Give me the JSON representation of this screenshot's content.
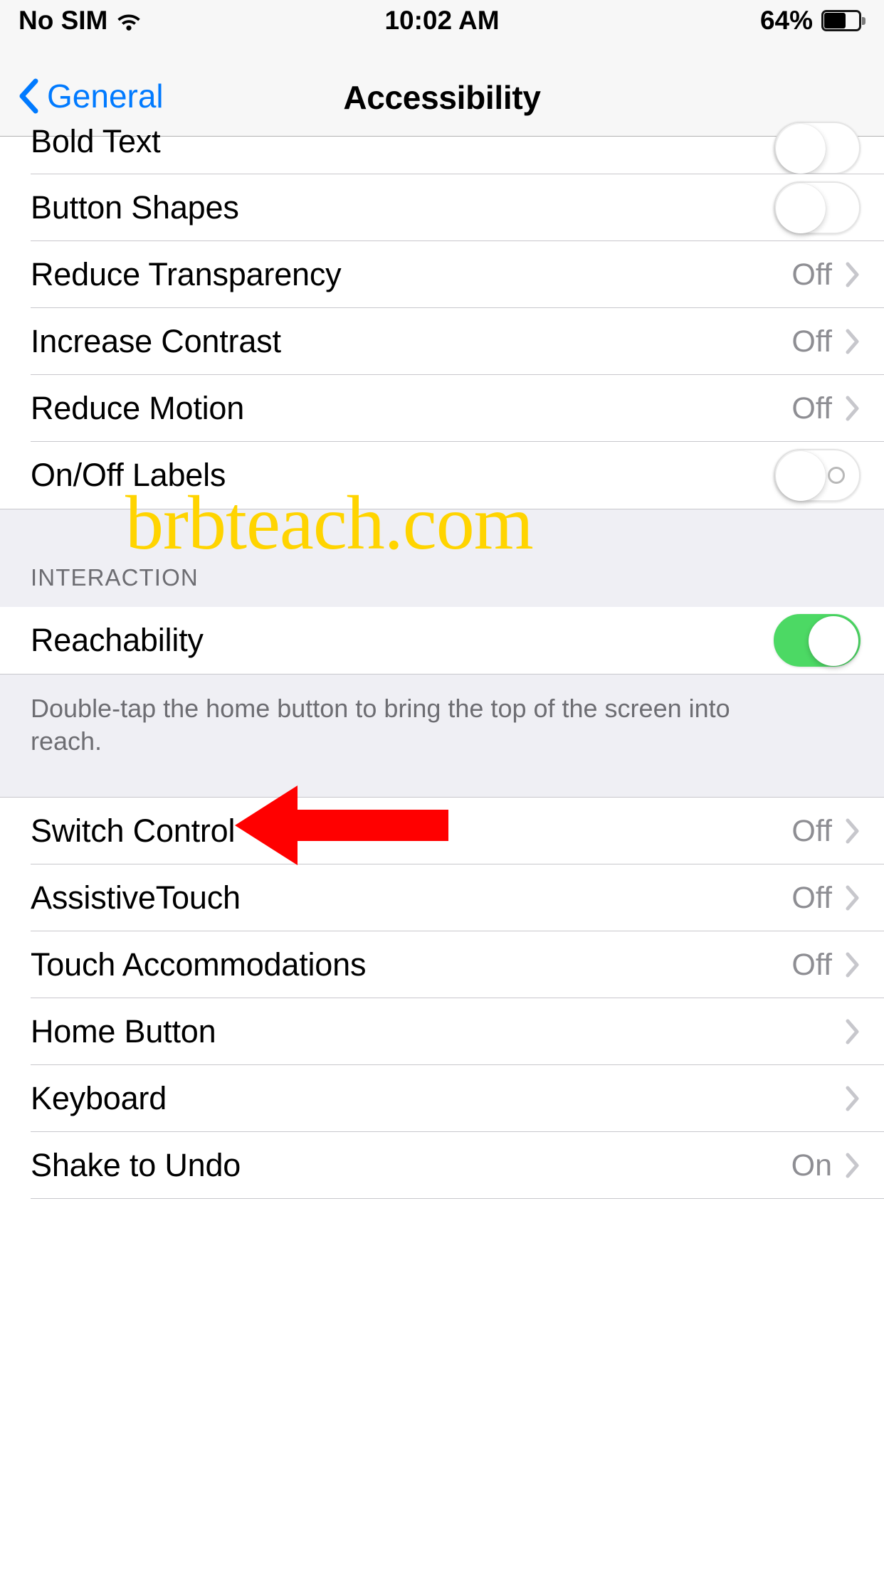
{
  "status_bar": {
    "carrier": "No SIM",
    "wifi_icon": "wifi-icon",
    "time": "10:02 AM",
    "battery_percent": "64%",
    "battery_icon": "battery-icon"
  },
  "nav_bar": {
    "back_label": "General",
    "back_icon": "chevron-left-icon",
    "title": "Accessibility"
  },
  "vision_section": {
    "rows": [
      {
        "label": "Bold Text",
        "control": "toggle",
        "toggle_on": false,
        "clipped": true
      },
      {
        "label": "Button Shapes",
        "control": "toggle",
        "toggle_on": false
      },
      {
        "label": "Reduce Transparency",
        "control": "disclosure",
        "value": "Off"
      },
      {
        "label": "Increase Contrast",
        "control": "disclosure",
        "value": "Off"
      },
      {
        "label": "Reduce Motion",
        "control": "disclosure",
        "value": "Off"
      },
      {
        "label": "On/Off Labels",
        "control": "toggle-labeled",
        "toggle_on": false
      }
    ]
  },
  "interaction_section": {
    "header": "INTERACTION",
    "rows": [
      {
        "label": "Reachability",
        "control": "toggle",
        "toggle_on": true
      }
    ],
    "footer": "Double-tap the home button to bring the top of the screen into reach."
  },
  "interaction_section_2": {
    "rows": [
      {
        "label": "Switch Control",
        "control": "disclosure",
        "value": "Off"
      },
      {
        "label": "AssistiveTouch",
        "control": "disclosure",
        "value": "Off"
      },
      {
        "label": "Touch Accommodations",
        "control": "disclosure",
        "value": "Off"
      },
      {
        "label": "Home Button",
        "control": "disclosure",
        "value": ""
      },
      {
        "label": "Keyboard",
        "control": "disclosure",
        "value": ""
      },
      {
        "label": "Shake to Undo",
        "control": "disclosure",
        "value": "On"
      }
    ]
  },
  "annotations": {
    "watermark_text": "brbteach.com",
    "watermark_color": "#ffd400",
    "arrow_color": "#ff0000",
    "arrow_target": "AssistiveTouch"
  },
  "colors": {
    "accent_blue": "#007aff",
    "toggle_on_green": "#4cd964",
    "value_grey": "#8e8e93",
    "chevron_grey": "#c7c7cc",
    "group_bg": "#efeff4",
    "separator": "#c8c7cc"
  }
}
